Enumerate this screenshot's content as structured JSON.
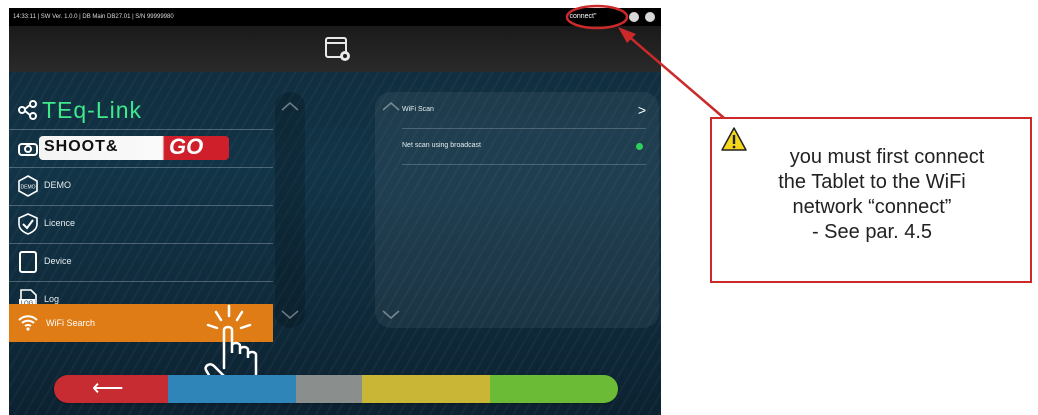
{
  "status_bar": {
    "info": "14:33:11 | SW Ver. 1.0.0 | DB Main DB27.01 | S/N 99999980",
    "wifi": "\"connect\""
  },
  "menu": {
    "teq_link": "TEq-Link",
    "shoot_go": {
      "shoot": "SHOOT&",
      "go": "GO"
    },
    "items": [
      {
        "label": "DEMO",
        "icon": "demo-icon"
      },
      {
        "label": "Licence",
        "icon": "licence-check-icon"
      },
      {
        "label": "Device",
        "icon": "tablet-device-icon"
      },
      {
        "label": "Log",
        "icon": "log-file-icon"
      },
      {
        "label": "WiFi Search",
        "icon": "wifi-icon",
        "active": true
      }
    ]
  },
  "right_panel": {
    "rows": [
      {
        "label": "WiFi Scan",
        "action": ">"
      },
      {
        "label": "Net scan using broadcast",
        "toggle": true
      }
    ]
  },
  "bottom_bar": {
    "back": "⟵",
    "colors": [
      "#c62c31",
      "#2f85b8",
      "#8a8f8d",
      "#c9b636",
      "#6cbb36"
    ]
  },
  "callout": {
    "line1": "you must first connect",
    "line2": "the Tablet to the WiFi",
    "line3": "network “connect”",
    "line4": "- See par. 4.5"
  },
  "colors": {
    "accent": "#e07c15",
    "teq_green": "#3ee98a",
    "callout_red": "#cc2a2a"
  }
}
